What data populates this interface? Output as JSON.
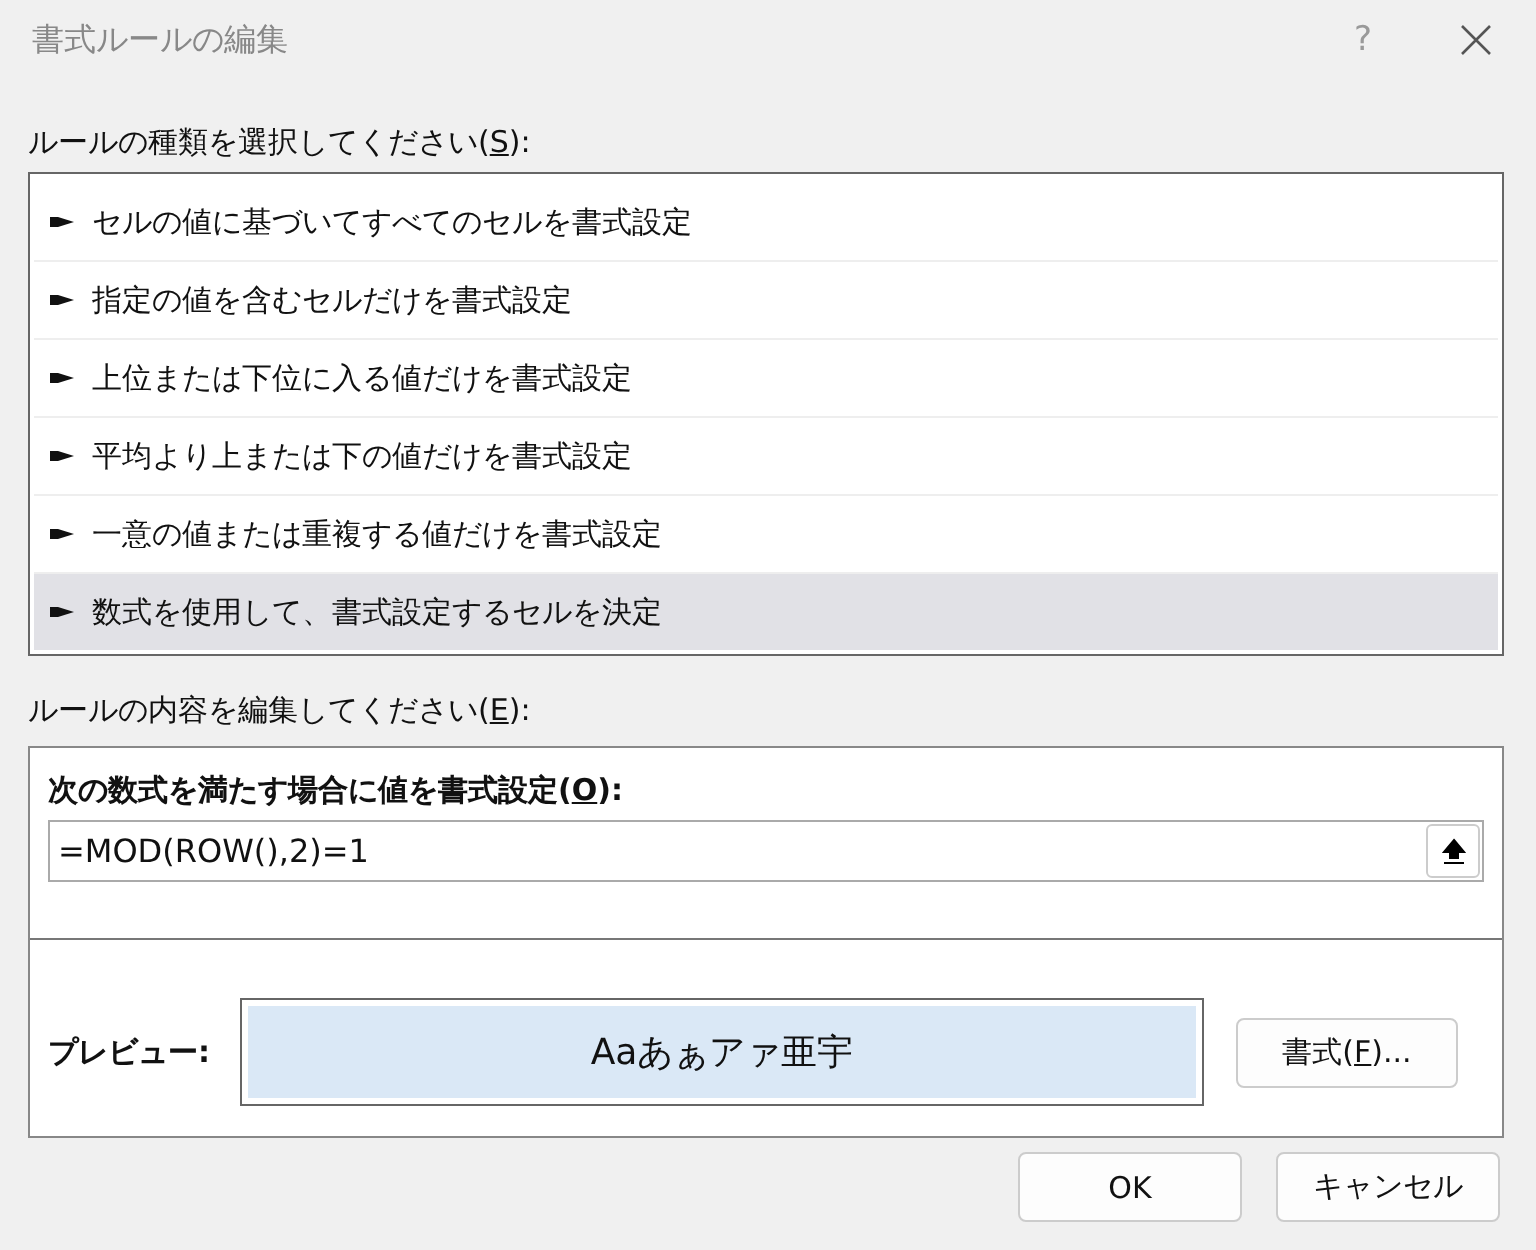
{
  "window": {
    "title": "書式ルールの編集",
    "help": "?"
  },
  "rule_type": {
    "label": {
      "text": "ルールの種類を選択してください(",
      "key": "S",
      "after": "):"
    },
    "items": [
      {
        "label": "セルの値に基づいてすべてのセルを書式設定",
        "selected": false
      },
      {
        "label": "指定の値を含むセルだけを書式設定",
        "selected": false
      },
      {
        "label": "上位または下位に入る値だけを書式設定",
        "selected": false
      },
      {
        "label": "平均より上または下の値だけを書式設定",
        "selected": false
      },
      {
        "label": "一意の値または重複する値だけを書式設定",
        "selected": false
      },
      {
        "label": "数式を使用して、書式設定するセルを決定",
        "selected": true
      }
    ]
  },
  "rule_edit": {
    "label": {
      "text": "ルールの内容を編集してください(",
      "key": "E",
      "after": "):"
    },
    "formula_label": {
      "text": "次の数式を満たす場合に値を書式設定(",
      "key": "O",
      "after": "):"
    },
    "formula": "=MOD(ROW(),2)=1",
    "preview_label": "プレビュー:",
    "preview_text": "Aaあぁアァ亜宇",
    "format_button": {
      "text": "書式(",
      "key": "F",
      "after": ")..."
    }
  },
  "buttons": [
    "OK",
    "キャンセル"
  ]
}
